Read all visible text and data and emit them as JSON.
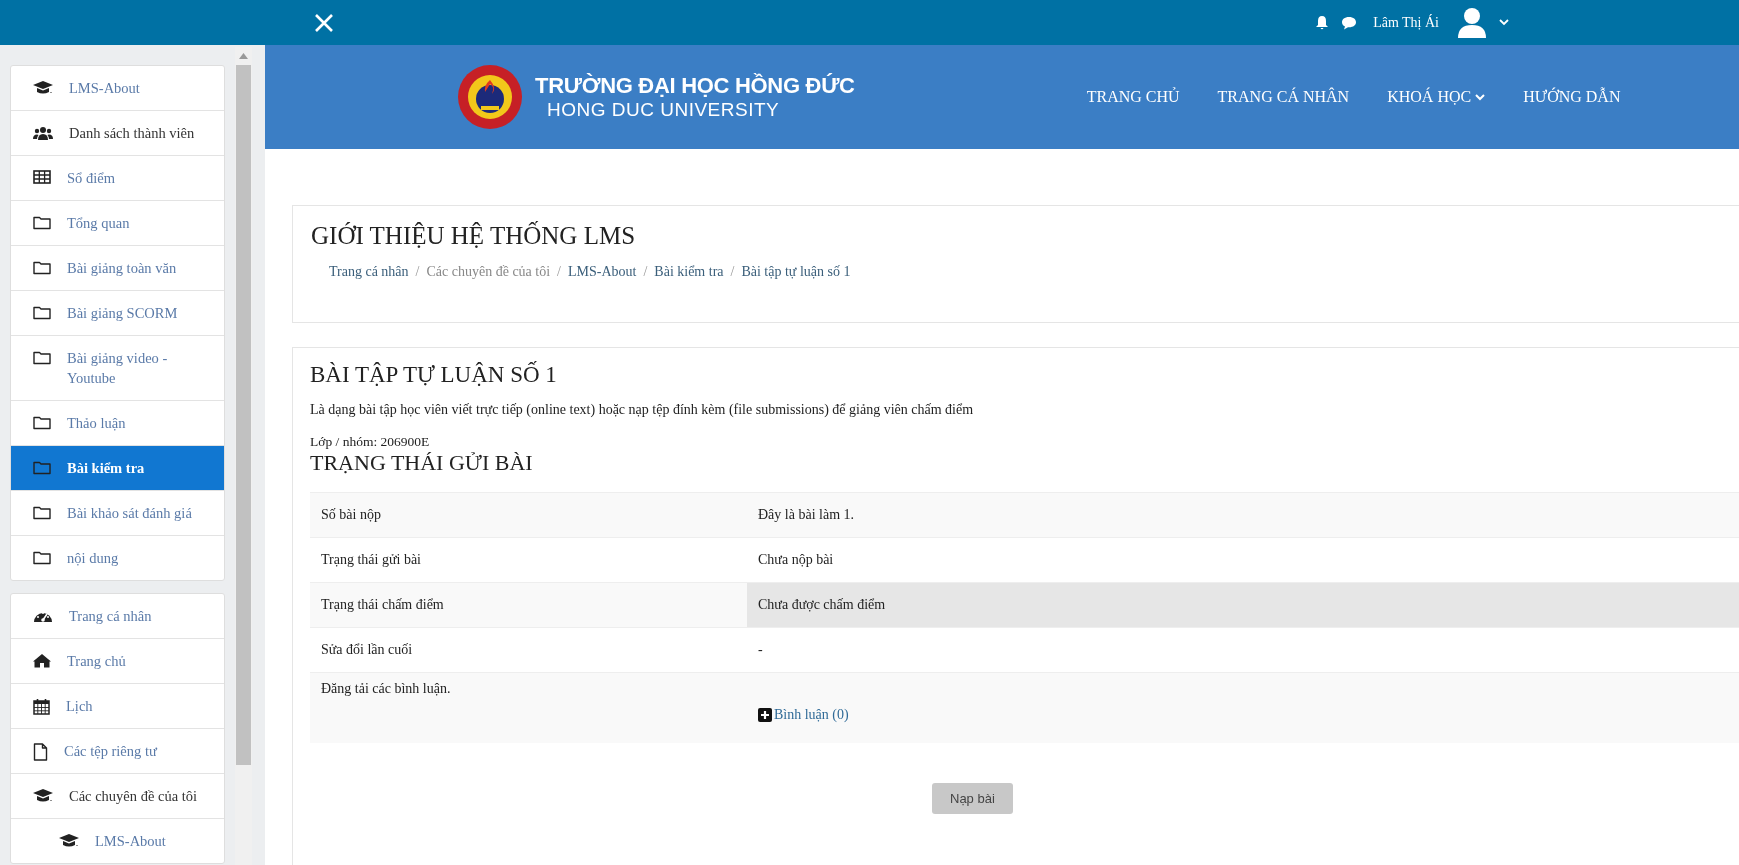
{
  "top_bar": {
    "user_name": "Lâm Thị Ái"
  },
  "sidebar": {
    "groups": [
      {
        "items": [
          {
            "label": "LMS-About",
            "kind": "graduation",
            "link": true,
            "selected": false
          },
          {
            "label": "Danh sách thành viên",
            "kind": "users",
            "link": false,
            "selected": false
          },
          {
            "label": "Sổ điểm",
            "kind": "table",
            "link": true,
            "selected": false
          },
          {
            "label": "Tổng quan",
            "kind": "folder",
            "link": true,
            "selected": false
          },
          {
            "label": "Bài giảng toàn văn",
            "kind": "folder",
            "link": true,
            "selected": false
          },
          {
            "label": "Bài giảng SCORM",
            "kind": "folder",
            "link": true,
            "selected": false
          },
          {
            "label": "Bài giảng video - Youtube",
            "kind": "folder",
            "link": true,
            "selected": false
          },
          {
            "label": "Thảo luận",
            "kind": "folder",
            "link": true,
            "selected": false
          },
          {
            "label": "Bài kiểm tra",
            "kind": "folder",
            "link": true,
            "selected": true
          },
          {
            "label": "Bài khảo sát đánh giá",
            "kind": "folder",
            "link": true,
            "selected": false
          },
          {
            "label": "nội dung",
            "kind": "folder",
            "link": true,
            "selected": false
          }
        ]
      },
      {
        "items": [
          {
            "label": "Trang cá nhân",
            "kind": "dashboard",
            "link": true,
            "selected": false
          },
          {
            "label": "Trang chủ",
            "kind": "home",
            "link": true,
            "selected": false
          },
          {
            "label": "Lịch",
            "kind": "calendar",
            "link": true,
            "selected": false
          },
          {
            "label": "Các tệp riêng tư",
            "kind": "file",
            "link": true,
            "selected": false
          },
          {
            "label": "Các chuyên đề của tôi",
            "kind": "graduation",
            "link": false,
            "selected": false,
            "children": [
              {
                "label": "LMS-About",
                "kind": "graduation",
                "link": true,
                "selected": false
              }
            ]
          }
        ]
      }
    ]
  },
  "banner": {
    "logo_title": "TRƯỜNG ĐẠI HỌC HỒNG ĐỨC",
    "logo_subtitle": "HONG DUC UNIVERSITY",
    "nav": [
      {
        "label": "TRANG CHỦ",
        "dropdown": false
      },
      {
        "label": "TRANG CÁ NHÂN",
        "dropdown": false
      },
      {
        "label": "KHOÁ HỌC",
        "dropdown": true
      },
      {
        "label": "HƯỚNG DẪN",
        "dropdown": false
      }
    ]
  },
  "course_header": {
    "title": "GIỚI THIỆU HỆ THỐNG LMS",
    "separator": "/",
    "breadcrumb": [
      {
        "label": "Trang cá nhân",
        "link": true
      },
      {
        "label": "Các chuyên đề của tôi",
        "link": false
      },
      {
        "label": "LMS-About",
        "link": true
      },
      {
        "label": "Bài kiểm tra",
        "link": true
      },
      {
        "label": "Bài tập tự luận số 1",
        "link": true
      }
    ]
  },
  "assignment": {
    "title": "BÀI TẬP TỰ LUẬN SỐ 1",
    "description": "Là dạng bài tập học viên viết trực tiếp (online text) hoặc nạp tệp đính kèm (file submissions) để giảng viên chấm điểm",
    "group": "Lớp / nhóm: 206900E",
    "status_heading": "TRẠNG THÁI GỬI BÀI",
    "rows": [
      {
        "label": "Số bài nộp",
        "value": "Đây là bài làm 1.",
        "kind": "text",
        "highlighted": false
      },
      {
        "label": "Trạng thái gửi bài",
        "value": "Chưa nộp bài",
        "kind": "text",
        "highlighted": false
      },
      {
        "label": "Trạng thái chấm điểm",
        "value": "Chưa được chấm điểm",
        "kind": "text",
        "highlighted": true
      },
      {
        "label": "Sửa đổi lần cuối",
        "value": "-",
        "kind": "text",
        "highlighted": false
      },
      {
        "label": "Đăng tải các bình luận.",
        "value": "Bình luận (0)",
        "kind": "comment",
        "highlighted": false
      }
    ],
    "submit_button": "Nạp bài"
  }
}
